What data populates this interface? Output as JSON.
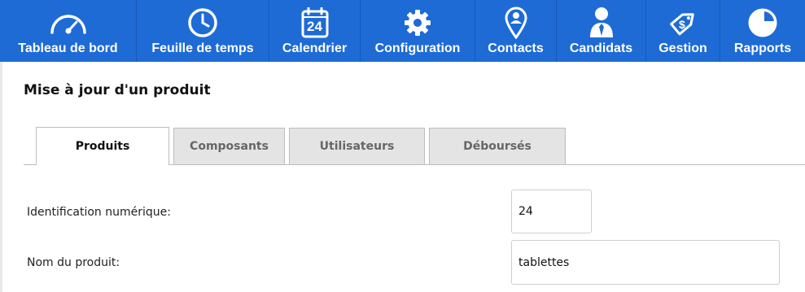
{
  "nav": {
    "items": [
      {
        "label": "Tableau de bord",
        "icon": "dashboard-gauge-icon"
      },
      {
        "label": "Feuille de temps",
        "icon": "clock-icon"
      },
      {
        "label": "Calendrier",
        "icon": "calendar-icon",
        "badge": "24"
      },
      {
        "label": "Configuration",
        "icon": "gear-icon"
      },
      {
        "label": "Contacts",
        "icon": "map-pin-person-icon"
      },
      {
        "label": "Candidats",
        "icon": "person-tie-icon"
      },
      {
        "label": "Gestion",
        "icon": "price-tag-dollar-icon"
      },
      {
        "label": "Rapports",
        "icon": "pie-chart-icon"
      }
    ],
    "background": "#1e6bd6"
  },
  "page": {
    "title": "Mise à jour d'un produit"
  },
  "tabs": [
    {
      "label": "Produits",
      "active": true
    },
    {
      "label": "Composants",
      "active": false
    },
    {
      "label": "Utilisateurs",
      "active": false
    },
    {
      "label": "Déboursés",
      "active": false
    }
  ],
  "form": {
    "id_label": "Identification numérique:",
    "id_value": "24",
    "name_label": "Nom du produit:",
    "name_value": "tablettes"
  }
}
